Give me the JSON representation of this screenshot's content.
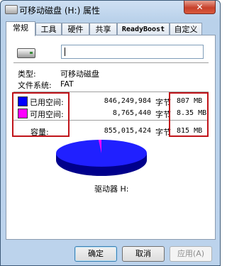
{
  "window": {
    "title": "可移动磁盘 (H:) 属性",
    "close_glyph": "✕"
  },
  "tabs": [
    {
      "label": "常规"
    },
    {
      "label": "工具"
    },
    {
      "label": "硬件"
    },
    {
      "label": "共享"
    },
    {
      "label": "ReadyBoost"
    },
    {
      "label": "自定义"
    }
  ],
  "general": {
    "drive_name_value": "",
    "type_label": "类型:",
    "type_value": "可移动磁盘",
    "fs_label": "文件系统:",
    "fs_value": "FAT",
    "used": {
      "label": "已用空间:",
      "bytes": "846,249,984",
      "unit": "字节",
      "size": "807 MB",
      "color": "#0000ff"
    },
    "free": {
      "label": "可用空间:",
      "bytes": "8,765,440",
      "unit": "字节",
      "size": "8.35 MB",
      "color": "#ff00ff"
    },
    "capacity": {
      "label": "容量:",
      "bytes": "855,015,424",
      "unit": "字节",
      "size": "815 MB"
    },
    "drive_caption": "驱动器 H:",
    "usage_fraction": 0.9897
  },
  "highlight_color": "#c0141a",
  "buttons": {
    "ok": "确定",
    "cancel": "取消",
    "apply": "应用(A)"
  },
  "icons": {
    "drive": "removable-drive-icon",
    "title": "removable-drive-icon"
  }
}
